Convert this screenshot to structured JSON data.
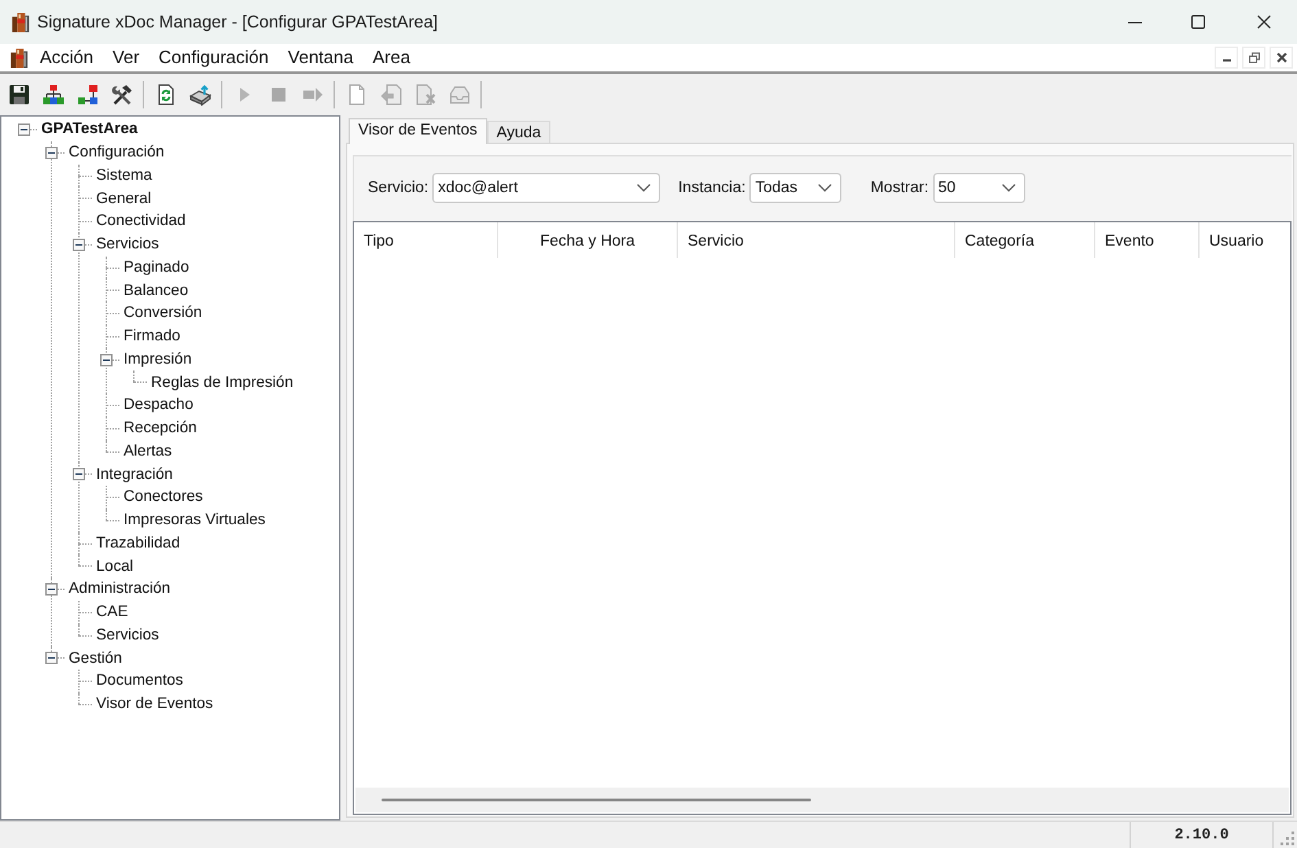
{
  "window": {
    "title": "Signature xDoc Manager - [Configurar GPATestArea]"
  },
  "menu": [
    "Acción",
    "Ver",
    "Configuración",
    "Ventana",
    "Area"
  ],
  "toolbar": [
    {
      "buttons": [
        {
          "kind": "save",
          "disabled": false
        },
        {
          "kind": "hierarchy",
          "disabled": false
        },
        {
          "kind": "network",
          "disabled": false
        },
        {
          "kind": "tools",
          "disabled": false
        }
      ]
    },
    {
      "buttons": [
        {
          "kind": "page-refresh",
          "disabled": false
        },
        {
          "kind": "disk-arrow",
          "disabled": false
        }
      ]
    },
    {
      "buttons": [
        {
          "kind": "play",
          "disabled": true
        },
        {
          "kind": "stop",
          "disabled": true
        },
        {
          "kind": "step",
          "disabled": true
        }
      ]
    },
    {
      "buttons": [
        {
          "kind": "page",
          "disabled": true
        },
        {
          "kind": "page-arrow",
          "disabled": true
        },
        {
          "kind": "page-cross",
          "disabled": true
        },
        {
          "kind": "tray",
          "disabled": true
        }
      ]
    }
  ],
  "tree": [
    {
      "label": "GPATestArea",
      "expanded": true,
      "children": [
        {
          "label": "Configuración",
          "expanded": true,
          "children": [
            {
              "label": "Sistema"
            },
            {
              "label": "General"
            },
            {
              "label": "Conectividad"
            },
            {
              "label": "Servicios",
              "expanded": true,
              "children": [
                {
                  "label": "Paginado"
                },
                {
                  "label": "Balanceo"
                },
                {
                  "label": "Conversión"
                },
                {
                  "label": "Firmado"
                },
                {
                  "label": "Impresión",
                  "expanded": true,
                  "children": [
                    {
                      "label": "Reglas de Impresión"
                    }
                  ]
                },
                {
                  "label": "Despacho"
                },
                {
                  "label": "Recepción"
                },
                {
                  "label": "Alertas"
                }
              ]
            },
            {
              "label": "Integración",
              "expanded": true,
              "children": [
                {
                  "label": "Conectores"
                },
                {
                  "label": "Impresoras Virtuales"
                }
              ]
            },
            {
              "label": "Trazabilidad"
            },
            {
              "label": "Local"
            }
          ]
        },
        {
          "label": "Administración",
          "expanded": true,
          "children": [
            {
              "label": "CAE"
            },
            {
              "label": "Servicios"
            }
          ]
        },
        {
          "label": "Gestión",
          "expanded": true,
          "children": [
            {
              "label": "Documentos"
            },
            {
              "label": "Visor de Eventos"
            }
          ]
        }
      ]
    }
  ],
  "tabs": [
    {
      "label": "Visor de Eventos",
      "selected": true
    },
    {
      "label": "Ayuda",
      "selected": false
    }
  ],
  "filters": [
    {
      "label": "Servicio:",
      "value": "xdoc@alert"
    },
    {
      "label": "Instancia:",
      "value": "Todas"
    },
    {
      "label": "Mostrar:",
      "value": "50"
    }
  ],
  "table": {
    "columns": [
      "Tipo",
      "Fecha y Hora",
      "Servicio",
      "Categoría",
      "Evento",
      "Usuario"
    ]
  },
  "status_bar": {
    "version": "2.10.0"
  }
}
